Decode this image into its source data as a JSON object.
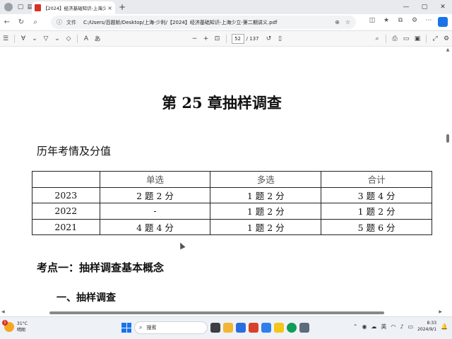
{
  "browser": {
    "tab_title": "【2024】经济基础知识-上海少立",
    "tab_close": "×",
    "new_tab": "+",
    "window_controls": [
      "—",
      "▢",
      "✕"
    ],
    "file_label": "文件",
    "url": "C:/Users/百题斩/Desktop/上海-少利/【2024】经济基础知识-上海少立-第二期讲义.pdf"
  },
  "pdf_toolbar": {
    "current_page": "52",
    "total_pages": "/ 137",
    "zoom_out": "−",
    "zoom_in": "+"
  },
  "document": {
    "title": "第 25 章抽样调查",
    "section_heading": "历年考情及分值",
    "table": {
      "headers": [
        "",
        "单选",
        "多选",
        "合计"
      ],
      "rows": [
        [
          "2023",
          "2 题 2 分",
          "1 题 2 分",
          "3 题 4 分"
        ],
        [
          "2022",
          "-",
          "1 题 2 分",
          "1 题 2 分"
        ],
        [
          "2021",
          "4 题 4 分",
          "1 题 2 分",
          "5 题 6 分"
        ]
      ]
    },
    "kaodian": "考点一：抽样调查基本概念",
    "subheading": "一、抽样调查"
  },
  "taskbar": {
    "weather_temp": "31°C",
    "weather_desc": "晴朗",
    "weather_badge": "1",
    "search_placeholder": "搜索",
    "ime": "英",
    "time": "8:33",
    "date": "2024/9/1"
  }
}
